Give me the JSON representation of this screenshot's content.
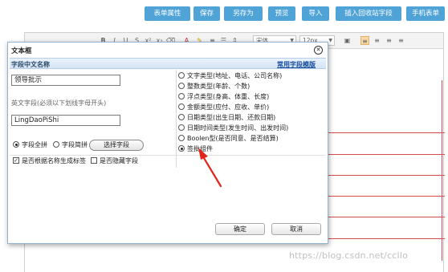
{
  "toolbar": {
    "buttons": [
      "表单属性",
      "保存",
      "另存为",
      "预览",
      "导入",
      "插入回收站字段",
      "手机表单"
    ]
  },
  "editor": {
    "font_name": "宋体",
    "font_size": "12px",
    "colors": {
      "accent": "#4fa3d7",
      "rule_line": "#d94b4b"
    }
  },
  "dialog": {
    "title": "文本框",
    "close_glyph": "✕",
    "section_title": "字段中文名称",
    "template_link": "常用字段模版",
    "cn_name_value": "领导批示",
    "en_field_hint": "英文字段(必须以下划线字母开头)",
    "en_name_value": "LingDaoPiShi",
    "pinyin_full_label": "字段全拼",
    "pinyin_short_label": "字段简拼",
    "pinyin_selected": "full",
    "select_field_button": "选择字段",
    "gen_label_checkbox": "是否根据名称生成标签",
    "gen_label_checked": true,
    "hide_field_checkbox": "是否隐藏字段",
    "hide_field_checked": false,
    "types": [
      {
        "label": "文字类型(地址、电话、公司名称)",
        "selected": false
      },
      {
        "label": "整数类型(年龄、个数)",
        "selected": false
      },
      {
        "label": "浮点类型(身高、体重、长度)",
        "selected": false
      },
      {
        "label": "金额类型(应付、应收、单价)",
        "selected": false
      },
      {
        "label": "日期类型(出生日期、还款日期)",
        "selected": false
      },
      {
        "label": "日期时间类型(发生时间、出发时间)",
        "selected": false
      },
      {
        "label": "Boolen型(是否同意、是否结算)",
        "selected": false
      },
      {
        "label": "签批组件",
        "selected": true
      }
    ],
    "ok_button": "确定",
    "cancel_button": "取消"
  },
  "annotation": {
    "arrow_color": "#e0241b"
  },
  "watermark": "https://blog.csdn.net/ccllo"
}
